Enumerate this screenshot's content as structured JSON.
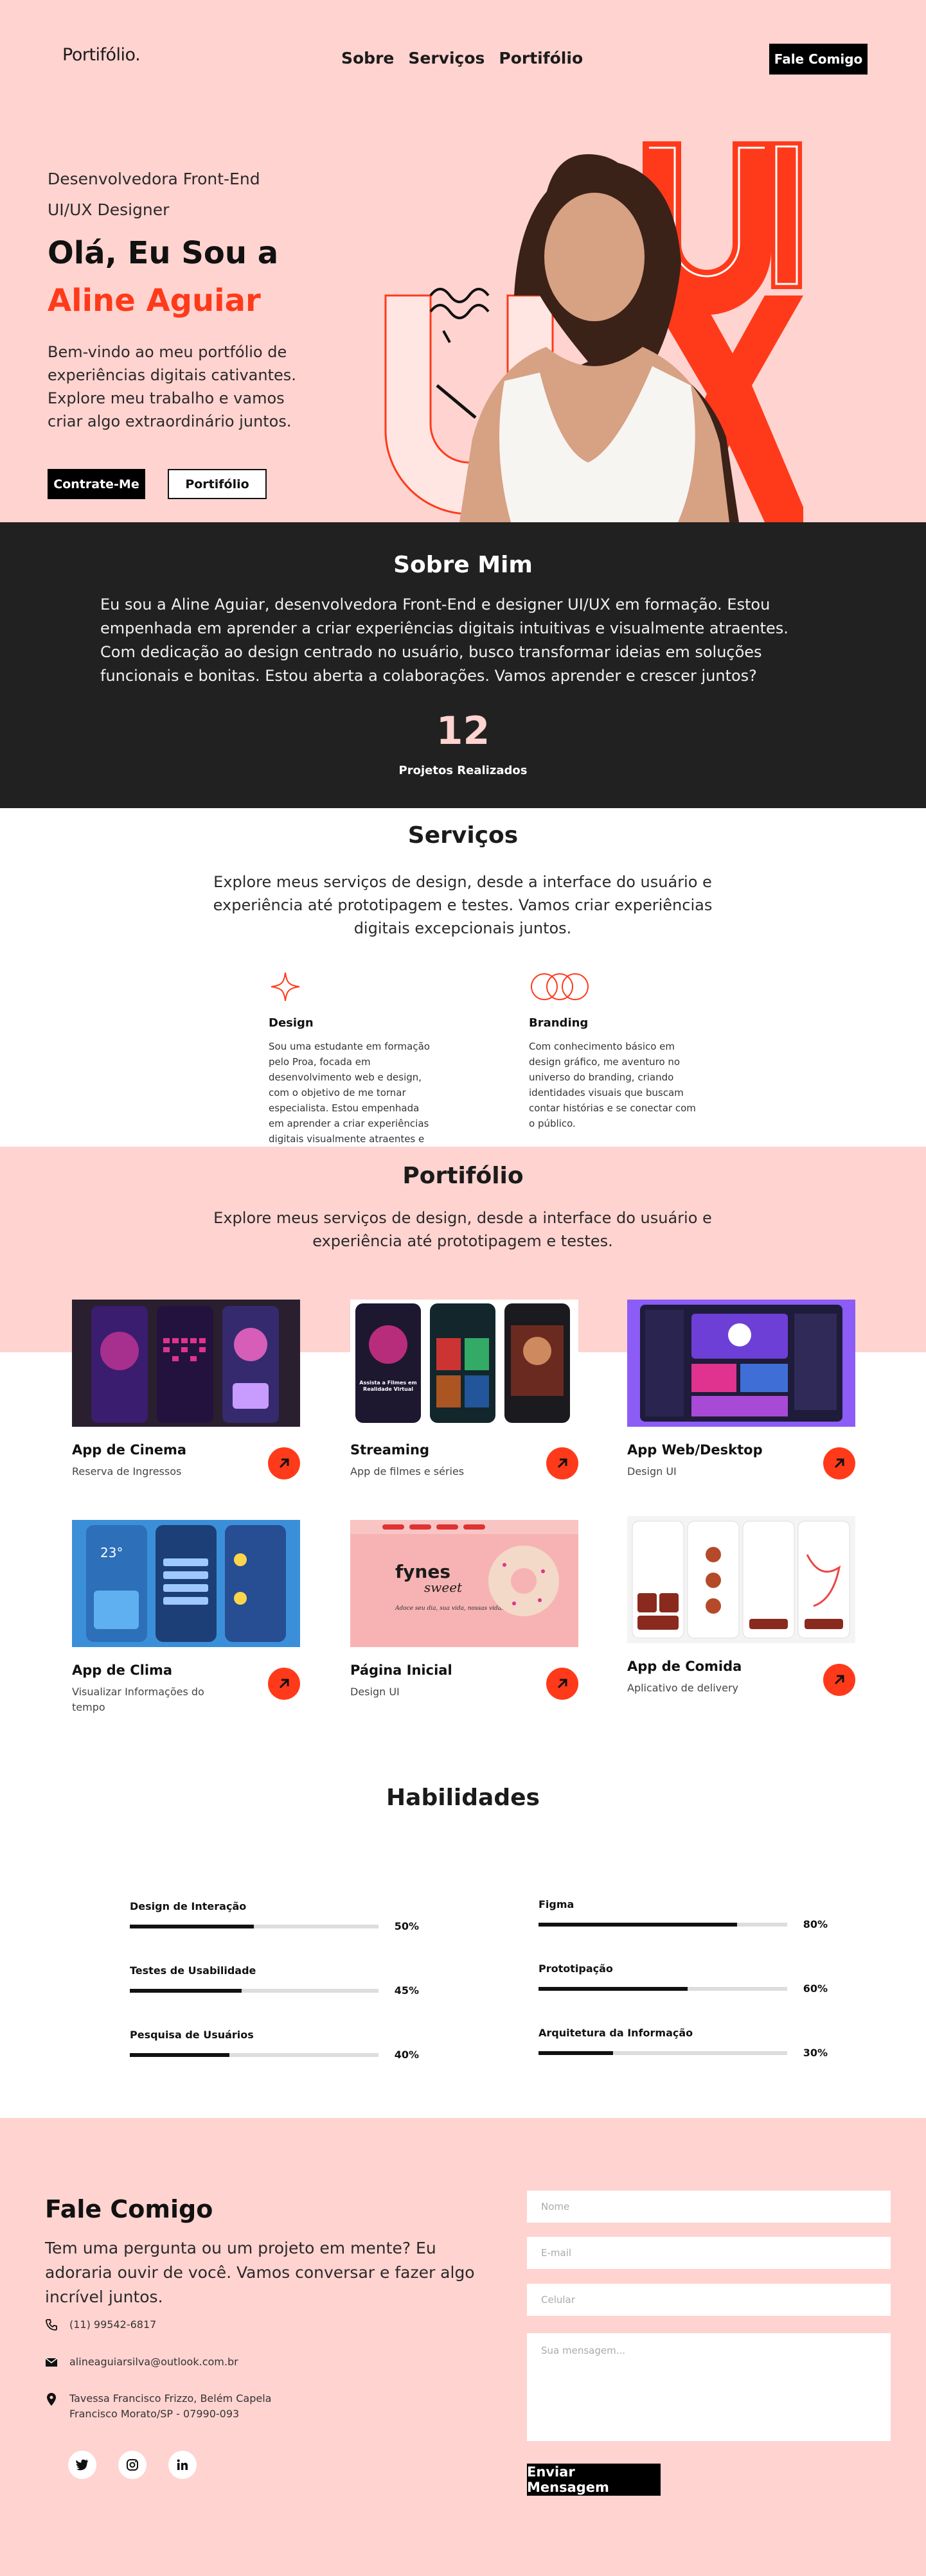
{
  "header": {
    "logo": "Portifólio.",
    "nav": [
      "Sobre",
      "Serviços",
      "Portifólio"
    ],
    "cta": "Fale Comigo"
  },
  "hero": {
    "subtitle_line1": "Desenvolvedora Front-End",
    "subtitle_line2": "UI/UX Designer",
    "greeting": "Olá, Eu Sou a",
    "name": "Aline Aguiar",
    "description": "Bem-vindo ao meu portfólio de experiências digitais cativantes. Explore meu trabalho e vamos criar algo extraordinário juntos.",
    "btn_hire": "Contrate-Me",
    "btn_portfolio": "Portifólio",
    "art_letters": [
      "UI",
      "UX"
    ]
  },
  "about": {
    "title": "Sobre Mim",
    "text": "Eu sou a Aline Aguiar, desenvolvedora Front-End e designer UI/UX em formação. Estou empenhada em aprender a criar experiências digitais intuitivas e visualmente atraentes. Com dedicação ao design centrado no usuário, busco transformar ideias em soluções funcionais e bonitas. Estou aberta a colaborações. Vamos aprender e crescer juntos?",
    "projects_count": "12",
    "projects_label": "Projetos Realizados"
  },
  "services": {
    "title": "Serviços",
    "description": "Explore meus serviços de design, desde a interface do usuário e experiência até prototipagem e testes. Vamos criar experiências digitais excepcionais juntos.",
    "items": [
      {
        "icon": "sparkle-icon",
        "title": "Design",
        "text": "Sou uma estudante em formação pelo Proa, focada em desenvolvimento web e design, com o objetivo de me tornar especialista. Estou empenhada em aprender a criar experiências digitais visualmente atraentes e fáceis de usar."
      },
      {
        "icon": "rings-icon",
        "title": "Branding",
        "text": "Com conhecimento básico em design gráfico, me aventuro no universo do branding, criando identidades visuais que buscam contar histórias e se conectar com o público."
      }
    ]
  },
  "portfolio": {
    "title": "Portifólio",
    "description": "Explore meus serviços de design, desde a interface do usuário e experiência até prototipagem e testes.",
    "items": [
      {
        "title": "App de Cinema",
        "subtitle": "Reserva de Ingressos"
      },
      {
        "title": "Streaming",
        "subtitle": "App de filmes e séries"
      },
      {
        "title": "App Web/Desktop",
        "subtitle": "Design UI"
      },
      {
        "title": "App de Clima",
        "subtitle": "Visualizar Informações do tempo"
      },
      {
        "title": "Página Inicial",
        "subtitle": "Design UI"
      },
      {
        "title": "App de Comida",
        "subtitle": "Aplicativo de delivery"
      }
    ],
    "thumb_texts": {
      "streaming_banner": "Assista a Filmes em Realidade Virtual",
      "landing_brand": "fynes",
      "landing_brand2": "sweet",
      "landing_tagline": "Adoce seu dia, sua vida, nossas vidas!",
      "weather_temp": "23°"
    }
  },
  "skills": {
    "title": "Habilidades",
    "left": [
      {
        "name": "Design de Interação",
        "percent": 50,
        "label": "50%"
      },
      {
        "name": "Testes de Usabilidade",
        "percent": 45,
        "label": "45%"
      },
      {
        "name": "Pesquisa de Usuários",
        "percent": 40,
        "label": "40%"
      }
    ],
    "right": [
      {
        "name": "Figma",
        "percent": 80,
        "label": "80%"
      },
      {
        "name": "Prototipação",
        "percent": 60,
        "label": "60%"
      },
      {
        "name": "Arquitetura da Informação",
        "percent": 30,
        "label": "30%"
      }
    ]
  },
  "contact": {
    "title": "Fale Comigo",
    "intro": "Tem uma pergunta ou um projeto em mente? Eu adoraria ouvir de você. Vamos conversar e fazer algo incrível juntos.",
    "phone": "(11) 99542-6817",
    "email": "alineaguiarsilva@outlook.com.br",
    "address_line1": "Tavessa Francisco Frizzo, Belém Capela",
    "address_line2": "Francisco Morato/SP - 07990-093",
    "form": {
      "name_placeholder": "Nome",
      "email_placeholder": "E-mail",
      "phone_placeholder": "Celular",
      "message_placeholder": "Sua mensagem...",
      "submit": "Enviar Mensagem"
    },
    "social": [
      "twitter-icon",
      "instagram-icon",
      "linkedin-icon"
    ]
  },
  "colors": {
    "accent": "#ff3a1a",
    "pink_bg": "#ffd3d0",
    "dark_bg": "#212121"
  }
}
